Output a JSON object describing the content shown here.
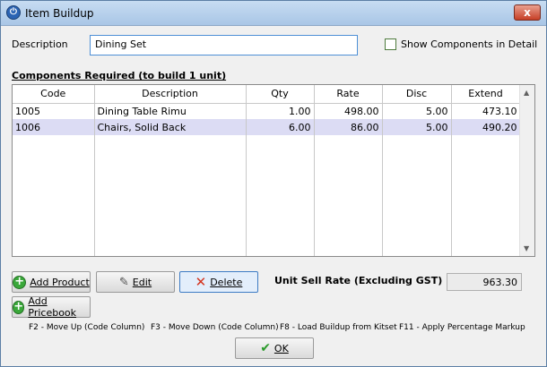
{
  "window": {
    "title": "Item Buildup",
    "close_label": "x"
  },
  "form": {
    "description_label": "Description",
    "description_value": "Dining Set",
    "show_components_label": "Show Components in Detail",
    "show_components_checked": false
  },
  "components": {
    "section_title": "Components Required (to build 1 unit)",
    "columns": [
      "Code",
      "Description",
      "Qty",
      "Rate",
      "Disc",
      "Extend"
    ],
    "rows": [
      {
        "code": "1005",
        "description": "Dining Table Rimu",
        "qty": "1.00",
        "rate": "498.00",
        "disc": "5.00",
        "extend": "473.10"
      },
      {
        "code": "1006",
        "description": "Chairs, Solid Back",
        "qty": "6.00",
        "rate": "86.00",
        "disc": "5.00",
        "extend": "490.20"
      }
    ]
  },
  "buttons": {
    "add_product": "Add Product",
    "edit": "Edit",
    "delete": "Delete",
    "add_pricebook": "Add Pricebook",
    "ok": "OK"
  },
  "summary": {
    "unit_sell_rate_label": "Unit Sell Rate (Excluding GST)",
    "unit_sell_rate_value": "963.30"
  },
  "help": {
    "f2": "F2 - Move Up (Code Column)",
    "f3": "F3 - Move Down (Code Column)",
    "f8": "F8 - Load Buildup from Kitset",
    "f11": "F11 - Apply Percentage Markup"
  },
  "colors": {
    "selected_row": "#dcdcf4",
    "accent": "#3d7bc4"
  }
}
